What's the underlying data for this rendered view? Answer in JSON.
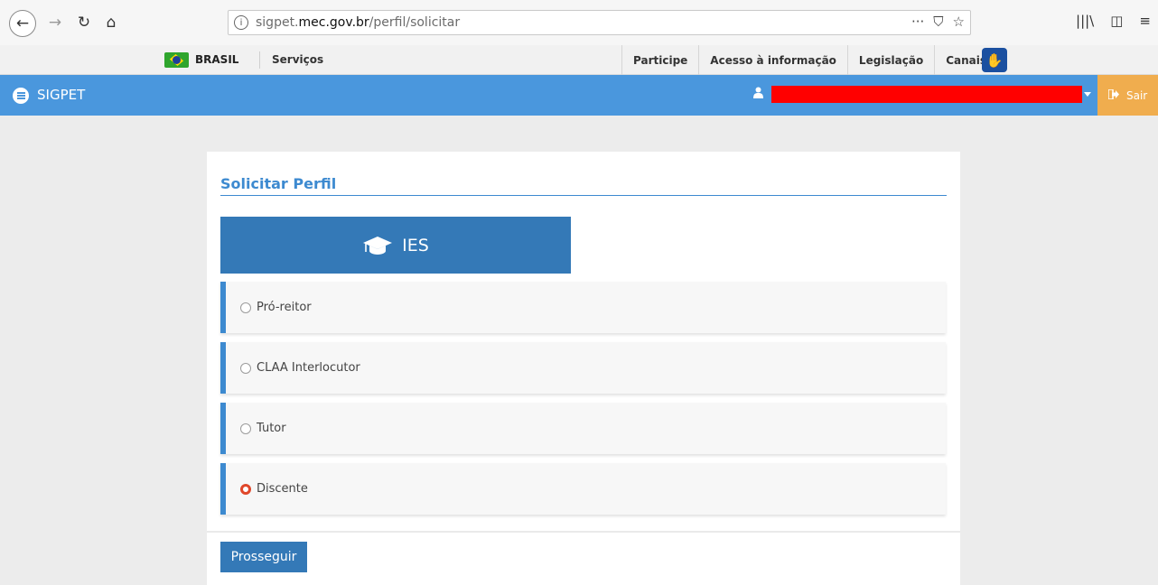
{
  "browser": {
    "url_prefix": "sigpet.",
    "url_host": "mec.gov.br",
    "url_path": "/perfil/solicitar",
    "info_glyph": "i",
    "more_glyph": "···",
    "pocket_glyph": "⛉",
    "bookmark_glyph": "☆",
    "library_glyph": "|||\\",
    "sidebar_glyph": "◫",
    "menu_glyph": "≡"
  },
  "govbar": {
    "brasil": "BRASIL",
    "servicos": "Serviços",
    "links": [
      "Participe",
      "Acesso à informação",
      "Legislação",
      "Canais"
    ]
  },
  "app": {
    "title": "SIGPET",
    "logout": "Sair",
    "header_color": "#4a97dd",
    "logout_color": "#f0ad4e"
  },
  "page": {
    "title": "Solicitar Perfil",
    "section": "IES",
    "options": [
      {
        "label": "Pró-reitor",
        "checked": false
      },
      {
        "label": "CLAA Interlocutor",
        "checked": false
      },
      {
        "label": "Tutor",
        "checked": false
      },
      {
        "label": "Discente",
        "checked": true
      }
    ],
    "submit": "Prosseguir",
    "accent": "#3479b7"
  }
}
